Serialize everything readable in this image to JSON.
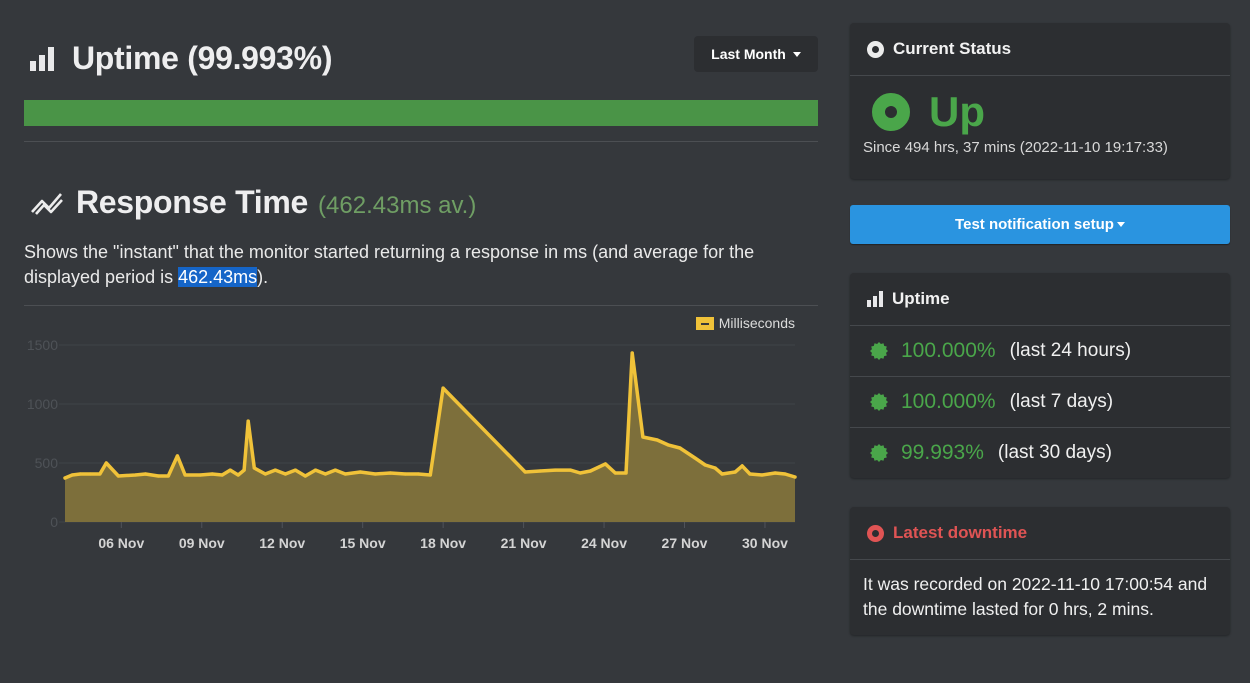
{
  "uptime_section": {
    "title": "Uptime (99.993%)",
    "icon": "bar-chart-icon",
    "range_button": "Last Month",
    "uptime_percent": 99.993,
    "bar_color": "#4a9447"
  },
  "response_section": {
    "title": "Response Time",
    "icon": "trend-line-icon",
    "average_label": "(462.43ms av.)",
    "description_before": "Shows the \"instant\" that the monitor started returning a response in ms (and average for the displayed period is ",
    "description_highlight": "462.43ms",
    "description_after": ")."
  },
  "chart_data": {
    "type": "area",
    "title": "",
    "xlabel": "",
    "ylabel": "",
    "legend": [
      {
        "name": "Milliseconds",
        "color": "#f0c239"
      }
    ],
    "legend_position": "top-right",
    "ylim": [
      0,
      1500
    ],
    "y_ticks": [
      0,
      500,
      1000,
      1500
    ],
    "x_tick_labels": [
      "06 Nov",
      "09 Nov",
      "12 Nov",
      "15 Nov",
      "18 Nov",
      "21 Nov",
      "24 Nov",
      "27 Nov",
      "30 Nov"
    ],
    "x_tick_days": [
      6,
      9,
      12,
      15,
      18,
      21,
      24,
      27,
      30
    ],
    "x_unit": "day of November 2022",
    "xlim": [
      3.9,
      31.12
    ],
    "grid": true,
    "series": [
      {
        "name": "Milliseconds",
        "color": "#f0c239",
        "x": [
          3.9,
          4.17,
          4.47,
          4.84,
          5.2,
          5.44,
          5.89,
          6.52,
          6.9,
          7.38,
          7.75,
          8.09,
          8.38,
          8.94,
          9.39,
          9.76,
          10.06,
          10.36,
          10.58,
          10.73,
          10.96,
          11.37,
          11.74,
          12.12,
          12.49,
          12.86,
          13.24,
          13.61,
          13.98,
          14.35,
          14.91,
          15.47,
          16.03,
          16.59,
          17.07,
          17.52,
          18.0,
          21.06,
          21.62,
          22.18,
          22.74,
          23.11,
          23.49,
          24.05,
          24.42,
          24.82,
          25.05,
          25.45,
          25.98,
          26.39,
          26.83,
          27.39,
          27.77,
          28.14,
          28.4,
          28.89,
          29.15,
          29.44,
          29.89,
          30.38,
          30.75,
          31.12
        ],
        "values": [
          373,
          398,
          407,
          407,
          407,
          500,
          390,
          398,
          407,
          390,
          390,
          560,
          398,
          398,
          407,
          398,
          440,
          398,
          440,
          855,
          458,
          407,
          440,
          407,
          440,
          390,
          440,
          407,
          440,
          407,
          424,
          407,
          415,
          407,
          407,
          398,
          1135,
          424,
          432,
          440,
          440,
          415,
          432,
          492,
          415,
          415,
          1432,
          720,
          695,
          653,
          627,
          542,
          483,
          458,
          407,
          424,
          475,
          407,
          398,
          415,
          407,
          381
        ]
      }
    ]
  },
  "current_status": {
    "title": "Current Status",
    "status": "Up",
    "since": "Since 494 hrs, 37 mins (2022-11-10 19:17:33)",
    "status_color": "#4aa64a"
  },
  "test_notification_button": "Test notification setup",
  "uptime_panel": {
    "title": "Uptime",
    "rows": [
      {
        "percent": "100.000%",
        "period": "(last 24 hours)"
      },
      {
        "percent": "100.000%",
        "period": "(last 7 days)"
      },
      {
        "percent": "99.993%",
        "period": "(last 30 days)"
      }
    ]
  },
  "latest_downtime": {
    "title": "Latest downtime",
    "text": "It was recorded on 2022-11-10 17:00:54 and the downtime lasted for 0 hrs, 2 mins.",
    "color": "#e05454"
  }
}
